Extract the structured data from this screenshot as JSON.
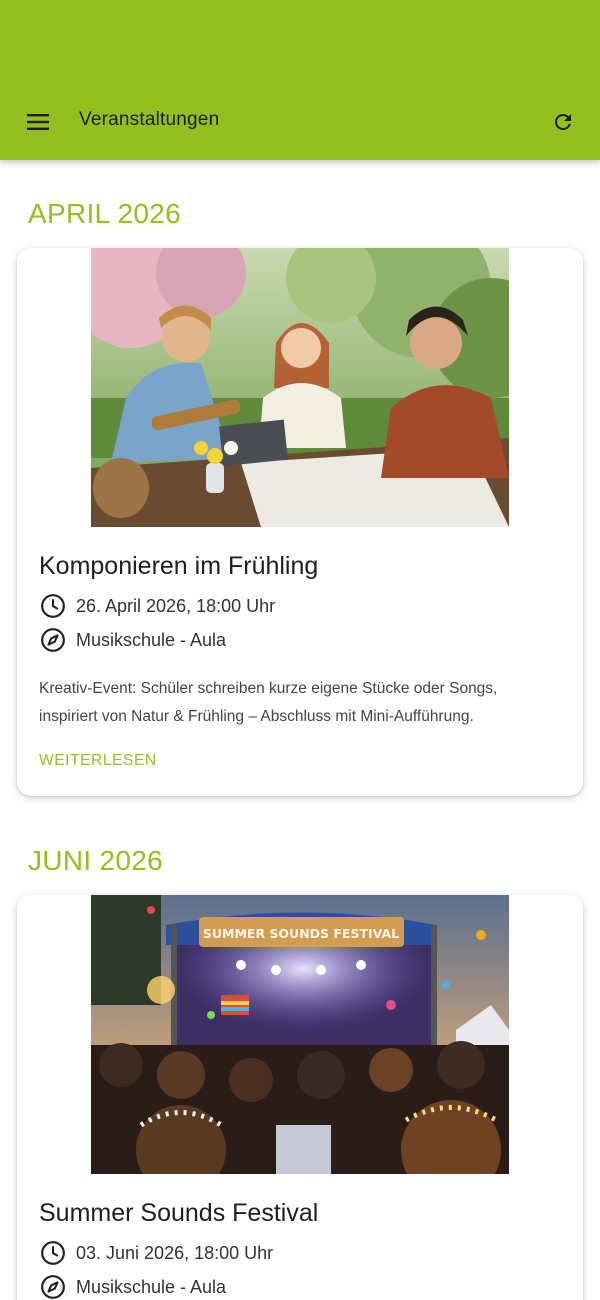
{
  "appbar": {
    "title": "Veranstaltungen",
    "menu_icon": "menu-icon",
    "refresh_icon": "refresh-icon",
    "color": "#93c01f"
  },
  "sections": [
    {
      "month": "APRIL 2026",
      "event": {
        "title": "Komponieren im Frühling",
        "datetime": "26. April 2026, 18:00 Uhr",
        "location": "Musikschule - Aula",
        "description": "Kreativ-Event: Schüler schreiben kurze eigene Stücke oder Songs, inspiriert von Natur & Frühling – Abschluss mit Mini-Aufführung.",
        "read_more": "WEITERLESEN"
      }
    },
    {
      "month": "JUNI 2026",
      "event": {
        "title": "Summer Sounds Festival",
        "datetime": "03. Juni 2026, 18:00 Uhr",
        "location": "Musikschule - Aula",
        "banner_text": "SUMMER SOUNDS FESTIVAL"
      }
    }
  ]
}
